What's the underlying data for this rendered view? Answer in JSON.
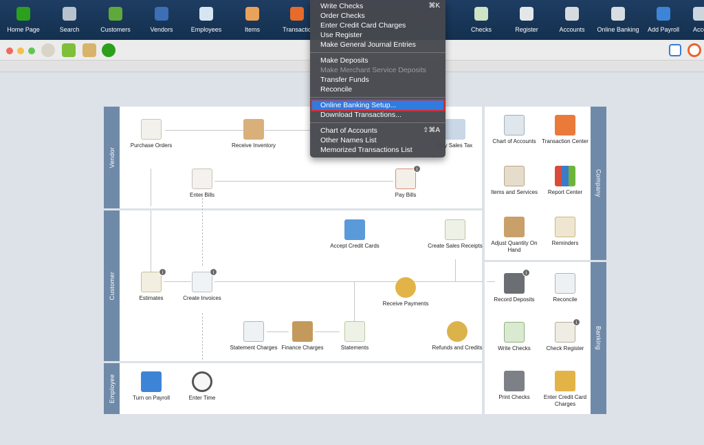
{
  "toolbar": {
    "items": [
      {
        "label": "Home Page",
        "icon": "qb-home-icon",
        "color": "#2ca01c"
      },
      {
        "label": "Search",
        "icon": "search-icon",
        "color": "#b9c3cf"
      },
      {
        "label": "Customers",
        "icon": "customers-icon",
        "color": "#5fa83a"
      },
      {
        "label": "Vendors",
        "icon": "vendors-icon",
        "color": "#3c6fb4"
      },
      {
        "label": "Employees",
        "icon": "employees-icon",
        "color": "#d7e4f2"
      },
      {
        "label": "Items",
        "icon": "items-icon",
        "color": "#e8a25a"
      },
      {
        "label": "Transactio",
        "icon": "transactions-icon",
        "color": "#e76b2b"
      },
      {
        "label": "Checks",
        "icon": "checks-icon",
        "color": "#cfe3c5"
      },
      {
        "label": "Register",
        "icon": "register-icon",
        "color": "#e4e7ea"
      },
      {
        "label": "Accounts",
        "icon": "accounts-icon",
        "color": "#d6dbe0"
      },
      {
        "label": "Online Banking",
        "icon": "bank-icon",
        "color": "#d8dde2"
      },
      {
        "label": "Add Payroll",
        "icon": "payroll-icon",
        "color": "#3e84d6"
      },
      {
        "label": "Acce",
        "icon": "accountant-icon",
        "color": "#cdd6df"
      }
    ]
  },
  "menu": {
    "items": [
      {
        "label": "Write Checks",
        "shortcut": "⌘K"
      },
      {
        "label": "Order Checks"
      },
      {
        "label": "Enter Credit Card Charges"
      },
      {
        "label": "Use Register"
      },
      {
        "label": "Make General Journal Entries"
      },
      {
        "separator": true
      },
      {
        "label": "Make Deposits"
      },
      {
        "label": "Make Merchant Service Deposits",
        "disabled": true
      },
      {
        "label": "Transfer Funds"
      },
      {
        "label": "Reconcile"
      },
      {
        "separator": true
      },
      {
        "label": "Online Banking Setup...",
        "highlighted": true
      },
      {
        "label": "Download Transactions..."
      },
      {
        "separator": true
      },
      {
        "label": "Chart of Accounts",
        "shortcut": "⇧⌘A"
      },
      {
        "label": "Other Names List"
      },
      {
        "label": "Memorized Transactions List"
      }
    ]
  },
  "sections": {
    "vendor": "Vendor",
    "customer": "Customer",
    "employee": "Employee",
    "company": "Company",
    "banking": "Banking"
  },
  "flow": {
    "purchase_orders": "Purchase Orders",
    "receive_inventory": "Receive Inventory",
    "pay_sales_tax": "Pay Sales Tax",
    "enter_bills": "Enter Bills",
    "pay_bills": "Pay Bills",
    "accept_credit_cards": "Accept Credit Cards",
    "create_sales_receipts": "Create Sales Receipts",
    "estimates": "Estimates",
    "create_invoices": "Create Invoices",
    "receive_payments": "Receive Payments",
    "statement_charges": "Statement Charges",
    "finance_charges": "Finance Charges",
    "statements": "Statements",
    "refunds_and_credits": "Refunds and Credits",
    "turn_on_payroll": "Turn on Payroll",
    "enter_time": "Enter Time",
    "chart_of_accounts": "Chart of Accounts",
    "transaction_center": "Transaction Center",
    "items_and_services": "Items and Services",
    "report_center": "Report Center",
    "adjust_quantity": "Adjust Quantity On Hand",
    "reminders": "Reminders",
    "record_deposits": "Record Deposits",
    "reconcile": "Reconcile",
    "write_checks": "Write Checks",
    "check_register": "Check Register",
    "print_checks": "Print Checks",
    "enter_credit_card_charges": "Enter Credit Card Charges"
  },
  "colors": {
    "toolbar_bg": "#1a3658",
    "menu_bg": "#46484e",
    "menu_highlight": "#2f7be0",
    "highlight_outline": "#d92a2a",
    "side_tab": "#6f8aa8"
  }
}
